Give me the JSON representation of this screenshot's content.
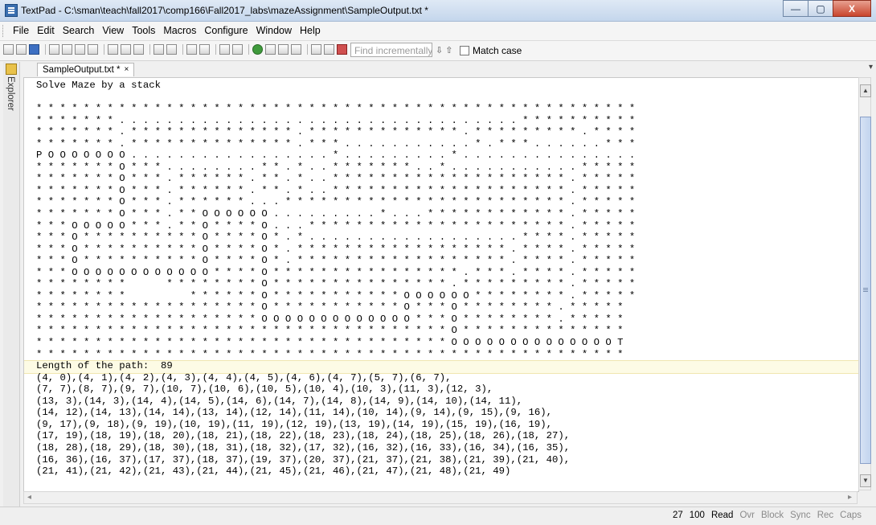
{
  "window": {
    "title": "TextPad - C:\\sman\\teach\\fall2017\\comp166\\Fall2017_labs\\mazeAssignment\\SampleOutput.txt *",
    "minimize": "—",
    "maximize": "▢",
    "close": "X"
  },
  "menu": [
    "File",
    "Edit",
    "Search",
    "View",
    "Tools",
    "Macros",
    "Configure",
    "Window",
    "Help"
  ],
  "toolbar": {
    "find_placeholder": "Find incrementally",
    "find_arrows": "⇩ ⇧",
    "match_case_label": "Match case"
  },
  "explorer": {
    "label": "Explorer"
  },
  "tab": {
    "name": "SampleOutput.txt *",
    "close": "×"
  },
  "document": {
    "lines": [
      "Solve Maze by a stack",
      "",
      "* * * * * * * * * * * * * * * * * * * * * * * * * * * * * * * * * * * * * * * * * * * * * * * * * * *",
      "* * * * * * * . . . . . . . . . . . . . . . . . . . . . . . . . . . . . . . . . . * * * * * * * * * *",
      "* * * * * * * . * * * * * * * * * * * * * * . * * * * * * * * * * * * * . * * * * * * * * * . * * * *",
      "* * * * * * * . * * * * * * * * * * * * * * . * * * . . . . . . . . . . . * . * * * . . . . . . * * *",
      "P O O O O O O O . . . . . . . . . . . . . . . . . * . . . . . . . . . * . . . . . . . . . . . . . . .",
      "* * * * * * * O * * * . . . . . . . . * * . * . . * * * * * * * . . * . . . . . . . . . . . * * * * *",
      "* * * * * * * O * * * . * * * * * * . * * . * . . * * * * * * * * * * * * * * * * * * * * . * * * * *",
      "* * * * * * * O * * * . * * * * * * . * * . * . . * * * * * * * * * * * * * * * * * * * * . * * * * *",
      "* * * * * * * O * * * . * * * * * * . . . * * * * * * * * * * * * * * * * * * * * * * * * . * * * * *",
      "* * * * * * * O * * * . * * O O O O O O . . . . . . . . . * . . . * * * * * * * * * * * * . * * * * *",
      "* * * O O O O O * * * . * * O * * * * O . . . * * * * * * * * * * * * * * * * * * * * * * . * * * * *",
      "* * * O * * * * * * * * * * O * * * * O * . * . . . . . . . . . . . . . . . . . . * * * * . * * * * *",
      "* * * O * * * * * * * * * * O * * * * O * . * * * * * * * * * * * * * * * * * * . * * * * . * * * * *",
      "* * * O * * * * * * * * * * O * * * * O * . * * * * * * * * * * * * * * * * * * . * * * * . * * * * *",
      "* * * O O O O O O O O O O O O * * * * O * * * * * * * * * * * * * * * * . * * * . * * * * . * * * * *",
      "* * * * * * * *       * * * * * * * * O * * * * * * * * * * * * * * * . * * * * * * * * * . * * * * *",
      "* * * * * * * *           * * * * * * O * * * * * * * * * * * O O O O O O * * * * * * * * . * * * * *",
      "* * * * * * * * * * * * * * * * * * * O * * * * * * * * * * * O * * * O * * * * * * * * . * * * * *",
      "* * * * * * * * * * * * * * * * * * * O O O O O O O O O O O O O * * * O * * * * * * * * . * * * * *",
      "* * * * * * * * * * * * * * * * * * * * * * * * * * * * * * * * * * * O * * * * * * * * * * * * * *",
      "* * * * * * * * * * * * * * * * * * * * * * * * * * * * * * * * * * * O O O O O O O O O O O O O O T",
      "* * * * * * * * * * * * * * * * * * * * * * * * * * * * * * * * * * * * * * * * * * * * * * * * * *",
      "Length of the path:  89",
      "(4, 0),(4, 1),(4, 2),(4, 3),(4, 4),(4, 5),(4, 6),(4, 7),(5, 7),(6, 7),",
      "(7, 7),(8, 7),(9, 7),(10, 7),(10, 6),(10, 5),(10, 4),(10, 3),(11, 3),(12, 3),",
      "(13, 3),(14, 3),(14, 4),(14, 5),(14, 6),(14, 7),(14, 8),(14, 9),(14, 10),(14, 11),",
      "(14, 12),(14, 13),(14, 14),(13, 14),(12, 14),(11, 14),(10, 14),(9, 14),(9, 15),(9, 16),",
      "(9, 17),(9, 18),(9, 19),(10, 19),(11, 19),(12, 19),(13, 19),(14, 19),(15, 19),(16, 19),",
      "(17, 19),(18, 19),(18, 20),(18, 21),(18, 22),(18, 23),(18, 24),(18, 25),(18, 26),(18, 27),",
      "(18, 28),(18, 29),(18, 30),(18, 31),(18, 32),(17, 32),(16, 32),(16, 33),(16, 34),(16, 35),",
      "(16, 36),(16, 37),(17, 37),(18, 37),(19, 37),(20, 37),(21, 37),(21, 38),(21, 39),(21, 40),",
      "(21, 41),(21, 42),(21, 43),(21, 44),(21, 45),(21, 46),(21, 47),(21, 48),(21, 49)"
    ]
  },
  "status": {
    "line": "27",
    "column": "100",
    "read": "Read",
    "ovr": "Ovr",
    "block": "Block",
    "sync": "Sync",
    "rec": "Rec",
    "caps": "Caps"
  }
}
